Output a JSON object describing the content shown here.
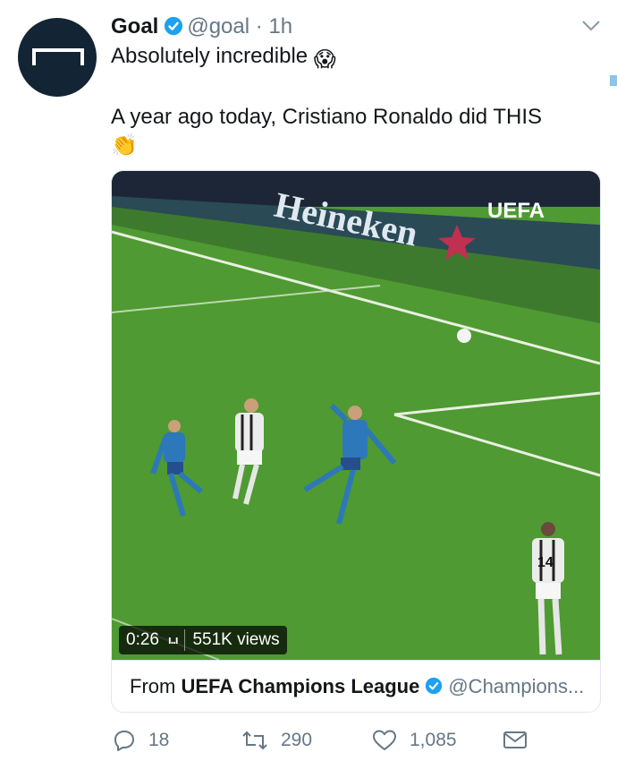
{
  "tweet": {
    "author_name": "Goal",
    "handle": "@goal",
    "separator": "·",
    "time": "1h",
    "line1": "Absolutely incredible",
    "line1_emoji": "😱",
    "line2": "A year ago today, Cristiano Ronaldo did THIS",
    "line3_emoji": "👏"
  },
  "icons": {
    "avatar_logo": "goal-logo-icon",
    "verified": "verified-badge-icon",
    "caret": "chevron-down-icon",
    "reply": "reply-icon",
    "retweet": "retweet-icon",
    "like": "heart-icon",
    "dm": "envelope-icon"
  },
  "media": {
    "duration": "0:26",
    "views": "551K views",
    "ad_board_text": "Heineken",
    "uefa_logo_text": "UEFA",
    "player_number": "14",
    "source_prefix": "From",
    "source_name": "UEFA Champions League",
    "source_handle": "@Champions..."
  },
  "stats": {
    "replies": "18",
    "retweets": "290",
    "likes": "1,085"
  },
  "colors": {
    "avatar_bg": "#132434",
    "verified_blue": "#1da1f2",
    "muted_text": "#657786",
    "pitch_green": "#4f9a32"
  }
}
